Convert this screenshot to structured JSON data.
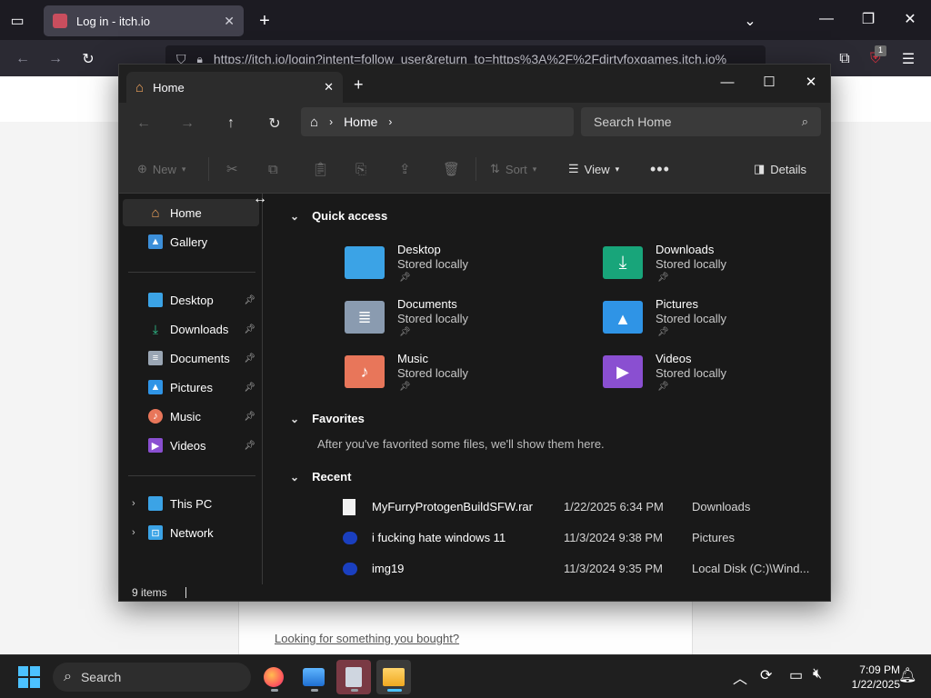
{
  "browser": {
    "tab_title": "Log in - itch.io",
    "url": "https://itch.io/login?intent=follow_user&return_to=https%3A%2F%2Fdirtyfoxgames.itch.io%",
    "extension_badge": "1",
    "page_link": "Looking for something you bought?"
  },
  "explorer": {
    "tab_title": "Home",
    "breadcrumb": "Home",
    "search_placeholder": "Search Home",
    "commands": {
      "new": "New",
      "sort": "Sort",
      "view": "View",
      "details": "Details"
    },
    "nav": {
      "home": "Home",
      "gallery": "Gallery",
      "desktop": "Desktop",
      "downloads": "Downloads",
      "documents": "Documents",
      "pictures": "Pictures",
      "music": "Music",
      "videos": "Videos",
      "this_pc": "This PC",
      "network": "Network"
    },
    "sections": {
      "quick_access": "Quick access",
      "favorites": "Favorites",
      "favorites_empty": "After you've favorited some files, we'll show them here.",
      "recent": "Recent"
    },
    "quick_access": [
      {
        "name": "Desktop",
        "sub": "Stored locally",
        "color": "#3ba3e6"
      },
      {
        "name": "Downloads",
        "sub": "Stored locally",
        "color": "#18a57a"
      },
      {
        "name": "Documents",
        "sub": "Stored locally",
        "color": "#8a9bb0"
      },
      {
        "name": "Pictures",
        "sub": "Stored locally",
        "color": "#2f94e6"
      },
      {
        "name": "Music",
        "sub": "Stored locally",
        "color": "#e8765a"
      },
      {
        "name": "Videos",
        "sub": "Stored locally",
        "color": "#8a4fd1"
      }
    ],
    "recent": [
      {
        "name": "MyFurryProtogenBuildSFW.rar",
        "date": "1/22/2025 6:34 PM",
        "location": "Downloads"
      },
      {
        "name": "i fucking hate windows 11",
        "date": "11/3/2024 9:38 PM",
        "location": "Pictures"
      },
      {
        "name": "img19",
        "date": "11/3/2024 9:35 PM",
        "location": "Local Disk (C:)\\Wind..."
      }
    ],
    "status": "9 items"
  },
  "taskbar": {
    "search": "Search",
    "time": "7:09 PM",
    "date": "1/22/2025"
  }
}
